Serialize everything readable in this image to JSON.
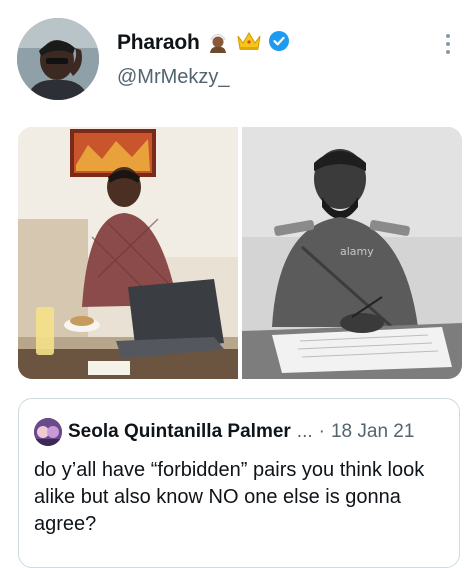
{
  "tweet": {
    "display_name": "Pharaoh",
    "badges": [
      "man-with-turban-emoji",
      "crown-emoji",
      "verified-badge-icon"
    ],
    "handle": "@MrMekzy_"
  },
  "media": {
    "photos": [
      {
        "kind": "photo",
        "subject": "man-with-laptop"
      },
      {
        "kind": "photo",
        "subject": "man-in-uniform-writing",
        "watermark": "alamy"
      }
    ]
  },
  "quoted_tweet": {
    "author": "Seola Quintanilla Palmer",
    "ellipsis": "...",
    "separator": "·",
    "date": "18 Jan 21",
    "text": "do y’all have “forbidden” pairs you think look alike but also know NO one else is gonna agree?"
  },
  "colors": {
    "verified": "#1d9bf0",
    "secondary_text": "#536471",
    "border": "#cfd9de",
    "crown": "#f5c518"
  }
}
